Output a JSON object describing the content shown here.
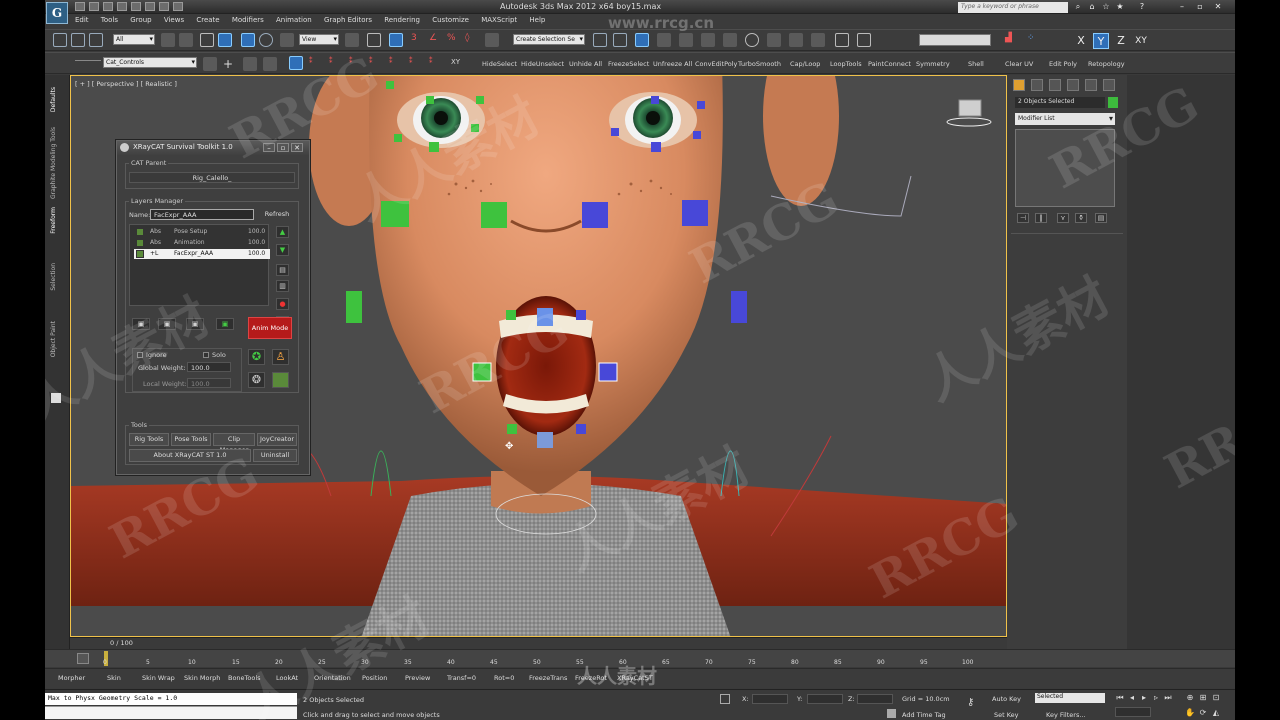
{
  "window": {
    "title": "Autodesk 3ds Max 2012 x64     boy15.max",
    "search_placeholder": "Type a keyword or phrase",
    "logo": "G"
  },
  "menu": [
    "Edit",
    "Tools",
    "Group",
    "Views",
    "Create",
    "Modifiers",
    "Animation",
    "Graph Editors",
    "Rendering",
    "Customize",
    "MAXScript",
    "Help"
  ],
  "toolbar1": {
    "selection_filter": "All",
    "ref_coord": "View",
    "named_selection": "Create Selection Se",
    "axes": [
      "X",
      "Y",
      "Z",
      "XY"
    ],
    "active_axis": "Y"
  },
  "toolbar2": {
    "layer_dropdown": "Cat_Controls",
    "xy_label": "XY",
    "buttons": [
      "HideSelect",
      "HideUnselect",
      "Unhide All",
      "FreezeSelect",
      "Unfreeze All",
      "ConvEditPoly",
      "TurboSmooth",
      "Cap/Loop",
      "LoopTools",
      "PaintConnect",
      "Symmetry",
      "Shell",
      "Clear UV",
      "Edit Poly",
      "Retopology"
    ]
  },
  "left_tabs": [
    "Defaults",
    "Graphite Modeling Tools",
    "Freeform",
    "Selection",
    "Object Paint"
  ],
  "viewport": {
    "label": "[ + ] [ Perspective ] [ Realistic ]"
  },
  "xray_panel": {
    "title": "XRayCAT Survival Toolkit 1.0",
    "cat_parent_label": "CAT Parent",
    "cat_parent_value": "Rig_Calello_",
    "layers_manager_label": "Layers Manager",
    "name_label": "Name:",
    "name_value": "FacExpr_AAA",
    "refresh": "Refresh",
    "layers": [
      {
        "mode": "Abs",
        "name": "Pose Setup",
        "weight": "100.0"
      },
      {
        "mode": "Abs",
        "name": "Animation",
        "weight": "100.0"
      },
      {
        "mode": "+L",
        "name": "FacExpr_AAA",
        "weight": "100.0"
      }
    ],
    "anim_mode": "Anim Mode",
    "ignore": "Ignore",
    "solo": "Solo",
    "global_weight_label": "Global Weight:",
    "global_weight": "100.0",
    "local_weight_label": "Local Weight:",
    "local_weight": "100.0",
    "tools_label": "Tools",
    "tool_buttons": [
      "Rig Tools",
      "Pose Tools",
      "Clip Manager",
      "JoyCreator"
    ],
    "about": "About XRayCAT ST 1.0",
    "uninstall": "Uninstall"
  },
  "command_panel": {
    "selection": "2 Objects Selected",
    "modifier_list": "Modifier List",
    "color": "#3dbb3d"
  },
  "timeline": {
    "frame_label": "0 / 100",
    "ticks": [
      "0",
      "5",
      "10",
      "15",
      "20",
      "25",
      "30",
      "35",
      "40",
      "45",
      "50",
      "55",
      "60",
      "65",
      "70",
      "75",
      "80",
      "85",
      "90",
      "95",
      "100"
    ]
  },
  "shelf": [
    "Morpher",
    "Skin",
    "Skin Wrap",
    "Skin Morph",
    "BoneTools",
    "LookAt",
    "Orientation",
    "Position",
    "Preview",
    "Transf=0",
    "Rot=0",
    "FreezeTrans",
    "FreezeRot",
    "XRayCatST"
  ],
  "status": {
    "maxscript": "Max to Physx Geometry Scale = 1.0",
    "objects_selected": "2 Objects Selected",
    "prompt": "Click and drag to select and move objects",
    "x_label": "X:",
    "y_label": "Y:",
    "z_label": "Z:",
    "grid": "Grid = 10.0cm",
    "add_time_tag": "Add Time Tag",
    "auto_key": "Auto Key",
    "set_key": "Set Key",
    "key_mode": "Selected",
    "key_filters": "Key Filters..."
  },
  "watermark": {
    "url": "www.rrcg.cn",
    "text": "RRCG",
    "cn": "人人素材",
    "logo": "人人素材"
  }
}
